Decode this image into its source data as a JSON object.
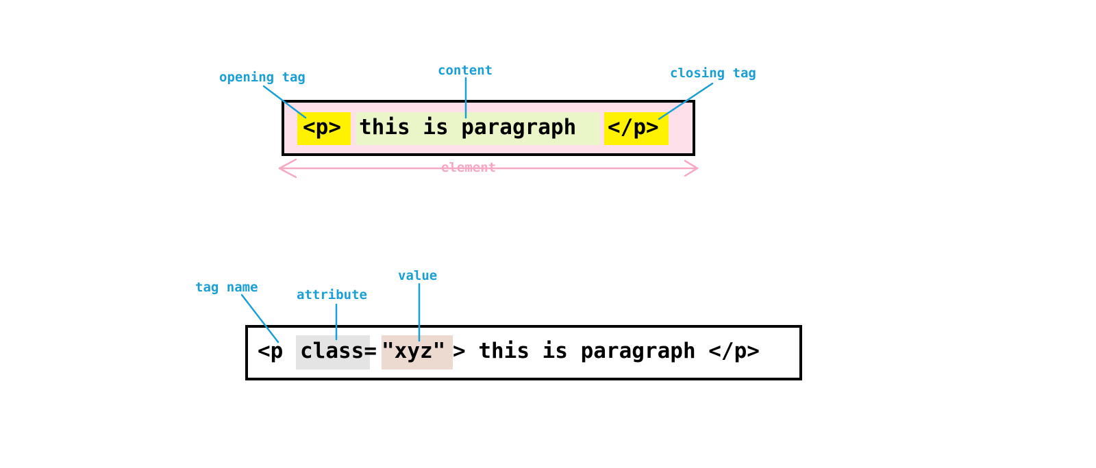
{
  "diagram1": {
    "labels": {
      "opening_tag": "opening tag",
      "content": "content",
      "closing_tag": "closing tag",
      "element": "element"
    },
    "code": {
      "open": "<p>",
      "content": "this is paragraph",
      "close": "</p>"
    }
  },
  "diagram2": {
    "labels": {
      "tag_name": "tag name",
      "attribute": "attribute",
      "value": "value"
    },
    "code": {
      "tag_name": "<p",
      "attribute": "class=",
      "value": "\"xyz\"",
      "rest": "> this is paragraph </p>"
    }
  },
  "colors": {
    "label": "#1a9fd4",
    "element_bg": "#fde0ea",
    "tag_highlight": "#fff200",
    "content_highlight": "#eaf5c8",
    "attribute_highlight": "#e4e4e4",
    "value_highlight": "#ecd9d0",
    "element_arrow": "#f7a8c3",
    "border": "#000000"
  }
}
